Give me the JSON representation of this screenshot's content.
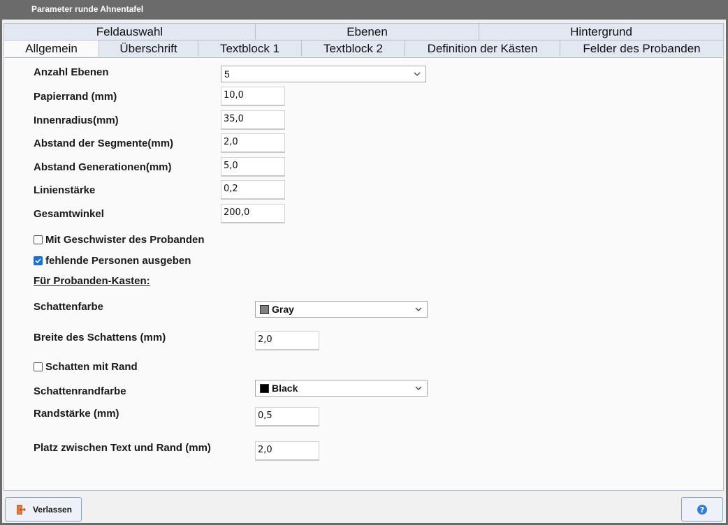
{
  "window": {
    "title": "Parameter runde Ahnentafel"
  },
  "tabs": {
    "row1": [
      {
        "label": "Feldauswahl"
      },
      {
        "label": "Ebenen"
      },
      {
        "label": "Hintergrund"
      }
    ],
    "row2": [
      {
        "label": "Allgemein",
        "active": true
      },
      {
        "label": "Überschrift"
      },
      {
        "label": "Textblock 1"
      },
      {
        "label": "Textblock 2"
      },
      {
        "label": "Definition der Kästen"
      },
      {
        "label": "Felder des Probanden"
      }
    ]
  },
  "form": {
    "anzahl_ebenen": {
      "label": "Anzahl Ebenen",
      "value": "5"
    },
    "papierrand": {
      "label": "Papierrand (mm)",
      "value": "10,0"
    },
    "innenradius": {
      "label": "Innenradius(mm)",
      "value": "35,0"
    },
    "abstand_segmente": {
      "label": "Abstand der Segmente(mm)",
      "value": "2,0"
    },
    "abstand_generationen": {
      "label": "Abstand Generationen(mm)",
      "value": "5,0"
    },
    "linienstaerke": {
      "label": "Linienstärke",
      "value": "0,2"
    },
    "gesamtwinkel": {
      "label": "Gesamtwinkel",
      "value": "200,0"
    },
    "geschwister": {
      "label": "Mit Geschwister des Probanden",
      "checked": false
    },
    "fehlende": {
      "label": "fehlende Personen ausgeben",
      "checked": true
    },
    "section_heading": "Für Probanden-Kasten:",
    "schattenfarbe": {
      "label": "Schattenfarbe",
      "value": "Gray",
      "swatch": "#808080"
    },
    "breite_schatten": {
      "label": "Breite des Schattens (mm)",
      "value": "2,0"
    },
    "schatten_rand": {
      "label": "Schatten mit Rand",
      "checked": false
    },
    "schattenrandfarbe": {
      "label": "Schattenrandfarbe",
      "value": "Black",
      "swatch": "#000000"
    },
    "randstaerke": {
      "label": "Randstärke (mm)",
      "value": "0,5"
    },
    "platz": {
      "label": "Platz zwischen Text und Rand (mm)",
      "value": "2,0"
    }
  },
  "footer": {
    "exit_label": "Verlassen",
    "exit_icon": "door-exit-icon",
    "help_icon": "help-icon"
  },
  "colors": {
    "accent": "#1f6fce",
    "titlebar": "#6b6b6b",
    "tab_bg": "#e2e8f2"
  }
}
